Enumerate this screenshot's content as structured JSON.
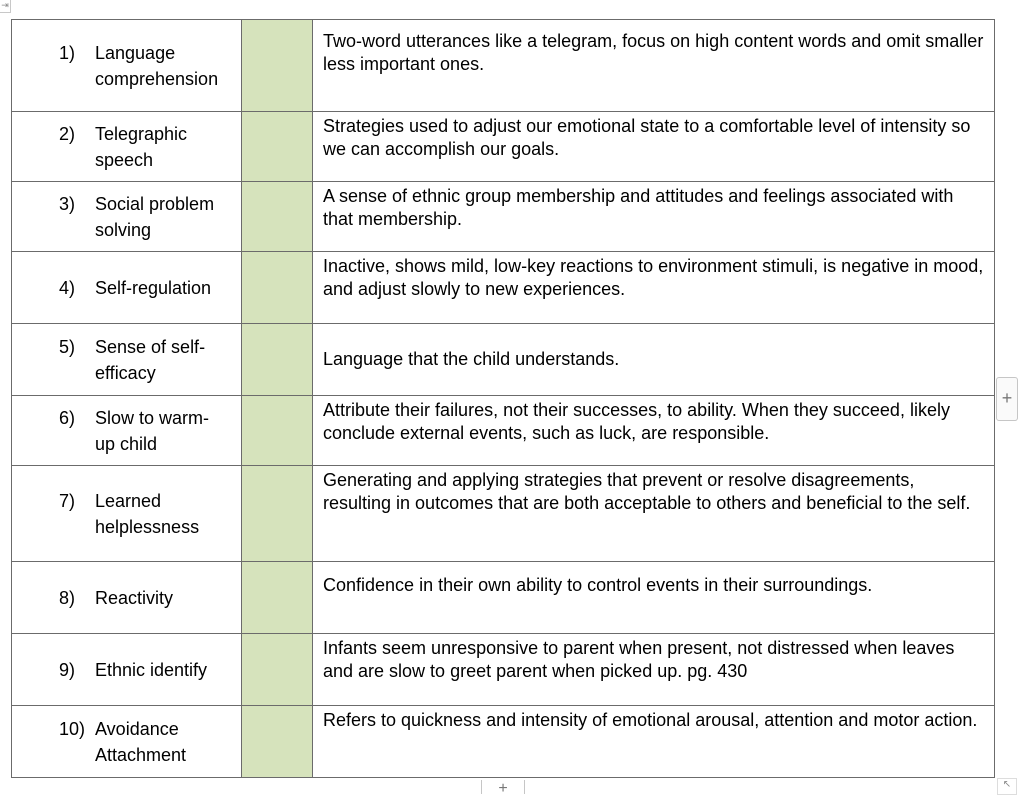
{
  "controls": {
    "move_icon": "⇥",
    "add_column_icon": "+",
    "add_row_icon": "+",
    "resize_icon": "↖"
  },
  "colors": {
    "answer_column": "#d6e3bc",
    "border": "#6b6b6b"
  },
  "rows": [
    {
      "num": "1)",
      "term": [
        "Language",
        "comprehension"
      ],
      "definition": "Two-word utterances like a telegram, focus on high content words and omit smaller less important ones.",
      "answer": ""
    },
    {
      "num": "2)",
      "term": [
        "Telegraphic",
        "speech"
      ],
      "definition": "Strategies used to adjust our emotional state to a comfortable level of intensity so we can accomplish our goals.",
      "answer": ""
    },
    {
      "num": "3)",
      "term": [
        "Social problem",
        "solving"
      ],
      "definition": "A sense of ethnic group membership and attitudes and feelings associated with that membership.",
      "answer": ""
    },
    {
      "num": "4)",
      "term": [
        "Self-regulation"
      ],
      "definition": "Inactive, shows mild, low-key reactions to environment stimuli, is negative in mood, and adjust slowly to new experiences.",
      "answer": ""
    },
    {
      "num": "5)",
      "term": [
        "Sense of self-",
        "efficacy"
      ],
      "definition": "Language that the child understands.",
      "answer": ""
    },
    {
      "num": "6)",
      "term": [
        "Slow to warm-",
        "up child"
      ],
      "definition": "Attribute their failures, not their successes, to ability. When they succeed, likely conclude external events, such as luck, are responsible.",
      "answer": ""
    },
    {
      "num": "7)",
      "term": [
        "Learned",
        "helplessness"
      ],
      "definition": "Generating and applying strategies that prevent or resolve disagreements, resulting in outcomes that are both acceptable to others and beneficial to the self.",
      "answer": ""
    },
    {
      "num": "8)",
      "term": [
        "Reactivity"
      ],
      "definition": "Confidence in their own ability to control events in their surroundings.",
      "answer": ""
    },
    {
      "num": "9)",
      "term": [
        "Ethnic identify"
      ],
      "definition": "Infants seem unresponsive to parent when present, not distressed when leaves and are slow to greet parent when picked up. pg. 430",
      "answer": ""
    },
    {
      "num": "10)",
      "term": [
        "Avoidance",
        "Attachment"
      ],
      "definition": "Refers to quickness and intensity of emotional arousal, attention and motor action.",
      "answer": ""
    }
  ]
}
